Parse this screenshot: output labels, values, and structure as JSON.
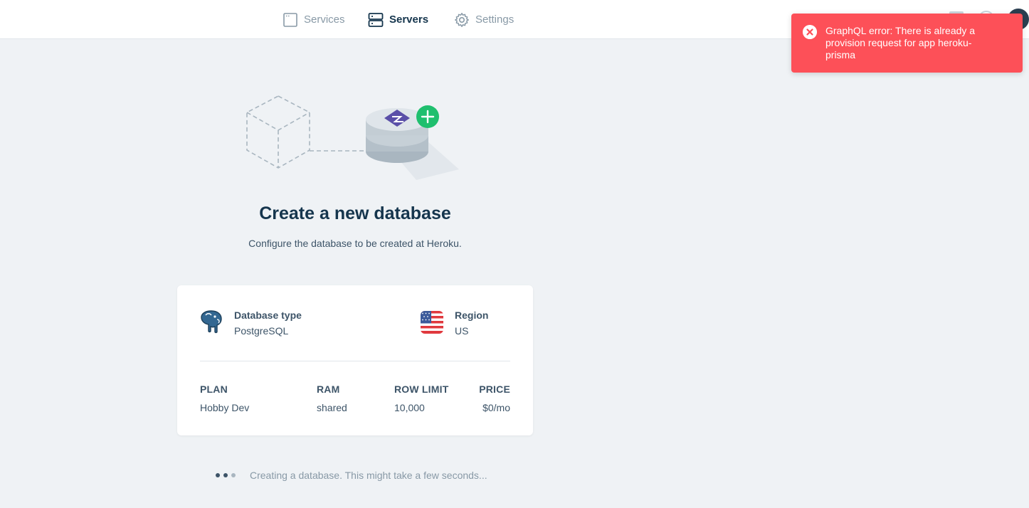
{
  "nav": {
    "services": "Services",
    "servers": "Servers",
    "settings": "Settings"
  },
  "toast": {
    "message": "GraphQL error: There is already a provision request for app heroku-prisma",
    "icon": "error-circle-icon",
    "color": "#fd5058"
  },
  "header": {
    "title": "Create a new database",
    "subtitle": "Configure the database to be created at Heroku."
  },
  "card": {
    "database_type_label": "Database type",
    "database_type_value": "PostgreSQL",
    "region_label": "Region",
    "region_value": "US",
    "plan_headers": [
      "PLAN",
      "RAM",
      "ROW LIMIT",
      "PRICE"
    ],
    "plan_row": [
      "Hobby Dev",
      "shared",
      "10,000",
      "$0/mo"
    ]
  },
  "status": {
    "text": "Creating a database. This might take a few seconds..."
  },
  "colors": {
    "accent_green": "#1fbf6e",
    "prisma_purple": "#5a4fa8",
    "text_dark": "#15354d"
  }
}
